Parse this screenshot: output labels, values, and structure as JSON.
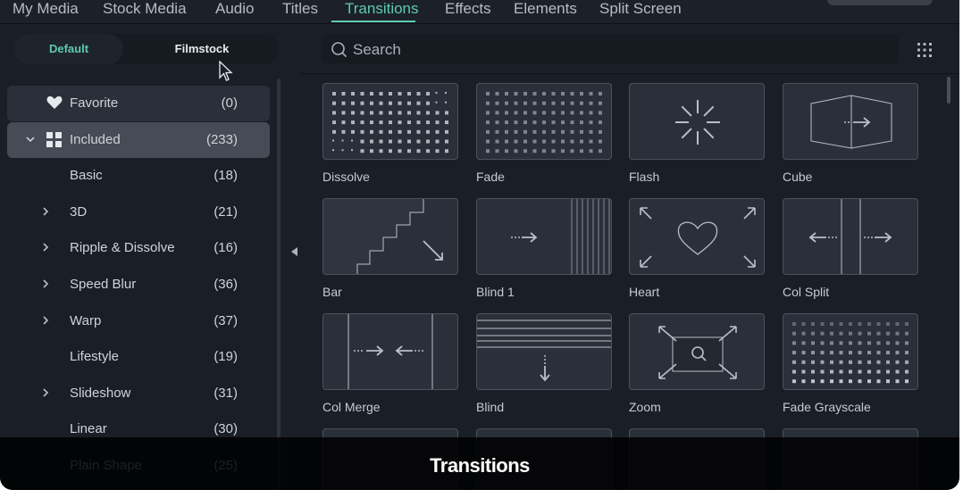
{
  "top_tabs": [
    {
      "label": "My Media",
      "active": false
    },
    {
      "label": "Stock Media",
      "active": false
    },
    {
      "label": "Audio",
      "active": false
    },
    {
      "label": "Titles",
      "active": false
    },
    {
      "label": "Transitions",
      "active": true
    },
    {
      "label": "Effects",
      "active": false
    },
    {
      "label": "Elements",
      "active": false
    },
    {
      "label": "Split Screen",
      "active": false
    }
  ],
  "colors": {
    "accent": "#5ec9b0",
    "background": "#1a1f27",
    "selected_row": "#454c56"
  },
  "segmented": {
    "default_label": "Default",
    "filmstock_label": "Filmstock",
    "active": "Default"
  },
  "sidebar": {
    "items": [
      {
        "label": "Favorite",
        "count": "(0)",
        "icon": "heart-icon"
      },
      {
        "label": "Included",
        "count": "(233)",
        "icon": "grid-icon",
        "expanded": true,
        "selected": true
      },
      {
        "label": "Basic",
        "count": "(18)",
        "has_children": false
      },
      {
        "label": "3D",
        "count": "(21)",
        "has_children": true
      },
      {
        "label": "Ripple & Dissolve",
        "count": "(16)",
        "has_children": true
      },
      {
        "label": "Speed Blur",
        "count": "(36)",
        "has_children": true
      },
      {
        "label": "Warp",
        "count": "(37)",
        "has_children": true
      },
      {
        "label": "Lifestyle",
        "count": "(19)",
        "has_children": false
      },
      {
        "label": "Slideshow",
        "count": "(31)",
        "has_children": true
      },
      {
        "label": "Linear",
        "count": "(30)",
        "has_children": false
      },
      {
        "label": "Plain Shape",
        "count": "(25)",
        "has_children": false
      }
    ]
  },
  "search": {
    "placeholder": "Search"
  },
  "transitions": [
    {
      "label": "Dissolve",
      "icon": "dissolve-thumb"
    },
    {
      "label": "Fade",
      "icon": "fade-thumb"
    },
    {
      "label": "Flash",
      "icon": "flash-thumb"
    },
    {
      "label": "Cube",
      "icon": "cube-thumb"
    },
    {
      "label": "Bar",
      "icon": "bar-thumb"
    },
    {
      "label": "Blind 1",
      "icon": "blind1-thumb"
    },
    {
      "label": "Heart",
      "icon": "heart-thumb"
    },
    {
      "label": "Col Split",
      "icon": "col-split-thumb"
    },
    {
      "label": "Col Merge",
      "icon": "col-merge-thumb"
    },
    {
      "label": "Blind",
      "icon": "blind-thumb"
    },
    {
      "label": "Zoom",
      "icon": "zoom-thumb"
    },
    {
      "label": "Fade Grayscale",
      "icon": "fade-grayscale-thumb"
    }
  ],
  "caption": {
    "text": "Transitions"
  }
}
